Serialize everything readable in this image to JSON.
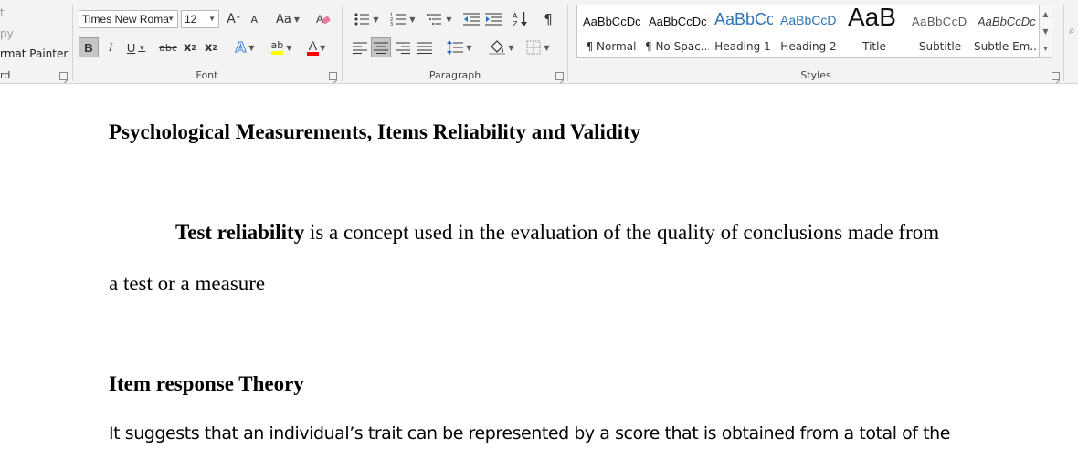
{
  "clipboard": {
    "cut": "t",
    "copy": "py",
    "format_painter": "rmat Painter",
    "label": "rd"
  },
  "font": {
    "family": "Times New Roma",
    "size": "12",
    "label": "Font",
    "grow": "A",
    "shrink": "A",
    "case": "Aa",
    "bold": "B",
    "italic": "I",
    "underline": "U",
    "strike": "abc",
    "subscript": "x",
    "subscript_mark": "2",
    "superscript": "x",
    "superscript_mark": "2",
    "effects": "A",
    "highlight": "ab",
    "color": "A",
    "highlight_color": "#ffff00",
    "font_color": "#ff0000"
  },
  "paragraph": {
    "label": "Paragraph",
    "show_marks": "¶",
    "sort": "A Z"
  },
  "styles": {
    "label": "Styles",
    "items": [
      {
        "preview": "AaBbCcDc",
        "name": "¶ Normal"
      },
      {
        "preview": "AaBbCcDc",
        "name": "¶ No Spac..."
      },
      {
        "preview": "AaBbCc",
        "name": "Heading 1"
      },
      {
        "preview": "AaBbCcD",
        "name": "Heading 2"
      },
      {
        "preview": "AaB",
        "name": "Title"
      },
      {
        "preview": "AaBbCcD",
        "name": "Subtitle"
      },
      {
        "preview": "AaBbCcDc",
        "name": "Subtle Em..."
      }
    ],
    "heading_color": "#2e74b5"
  },
  "document": {
    "title": "Psychological Measurements, Items Reliability and Validity",
    "p1_bold": "Test reliability",
    "p1_rest": " is a concept used in the evaluation of the quality of conclusions made from",
    "p1_line2": "a test or a measure",
    "heading2": "Item response Theory",
    "p2_line1": "It suggests that an individual’s trait can be represented by a score that is obtained from a total of the"
  }
}
